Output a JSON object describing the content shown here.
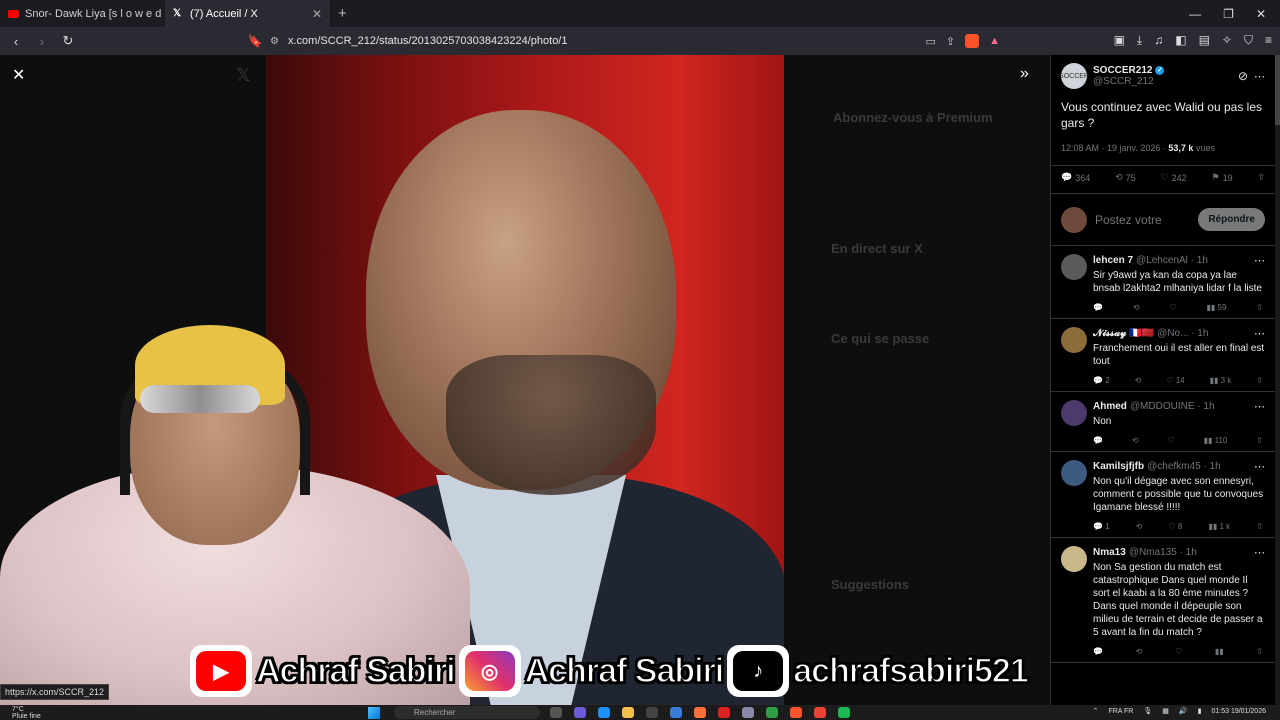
{
  "browser": {
    "tabs": [
      {
        "title": "Snor- Dawk Liya [s l o w e d + reve",
        "icon": "youtube-icon",
        "active": false
      },
      {
        "title": "(7) Accueil / X",
        "icon": "x-icon",
        "active": true
      }
    ],
    "new_tab": "+",
    "window_controls": [
      "—",
      "❐",
      "✕"
    ],
    "url": "x.com/SCCR_212/status/2013025703038423224/photo/1",
    "status_url": "https://x.com/SCCR_212"
  },
  "viewer": {
    "close": "✕",
    "expand": "»",
    "ghost_sidebar": {
      "premium_title": "Abonnez-vous à Premium",
      "live_title": "En direct sur X",
      "happening_title": "Ce qui se passe",
      "suggestions_title": "Suggestions"
    }
  },
  "overlay_banner": {
    "youtube_name": "Achraf Sabiri",
    "instagram_name": "Achraf Sabiri",
    "tiktok_name": "achrafsabiri521"
  },
  "post": {
    "author_name": "SOCCER212",
    "author_handle": "@SCCR_212",
    "avatar_text": "SOCCER",
    "text": "Vous continuez avec Walid ou pas les gars ?",
    "timestamp": "12:08 AM · 19 janv. 2026 · ",
    "views_count": "53,7 k",
    "views_label": " vues",
    "stats": {
      "replies": "364",
      "reposts": "75",
      "likes": "242",
      "bookmarks": "19"
    }
  },
  "reply_box": {
    "placeholder": "Postez votre",
    "button": "Répondre"
  },
  "replies": [
    {
      "name": "lehcen 7",
      "handle": "@LehcenAl · 1h",
      "text": "Sir y9awd ya kan da copa ya lae bnsab l2akhta2 mlhaniya lidar f la liste",
      "replies": "",
      "reposts": "",
      "likes": "",
      "views": "59",
      "avatar_color": "#5a5a5a"
    },
    {
      "name": "𝓝𝓲𝓼𝓼𝓪𝔂 🇫🇷🇲🇦",
      "handle": "@No... · 1h",
      "text": "Franchement oui il est aller en final est tout",
      "replies": "2",
      "reposts": "",
      "likes": "14",
      "views": "3 k",
      "avatar_color": "#8a6d3b"
    },
    {
      "name": "Ahmed",
      "handle": "@MDDOUINE · 1h",
      "text": "Non",
      "replies": "",
      "reposts": "",
      "likes": "",
      "views": "110",
      "avatar_color": "#4b3a6b"
    },
    {
      "name": "Kamilsjfjfb",
      "handle": "@chefkm45 · 1h",
      "text": "Non qu'il dégage avec son ennesyri, comment c possible que tu convoques Igamane blessé !!!!!",
      "replies": "1",
      "reposts": "",
      "likes": "8",
      "views": "1 k",
      "avatar_color": "#3d5a80"
    },
    {
      "name": "Nma13",
      "handle": "@Nma135 · 1h",
      "text": "Non Sa gestion du match est catastrophique Dans quel monde Il sort el kaabi a la 80 ème minutes ? Dans quel monde il dépeuple son milieu de terrain et decide de passer a 5 avant la fin du match ?",
      "replies": "",
      "reposts": "",
      "likes": "",
      "views": "",
      "avatar_color": "#c9b88a"
    }
  ],
  "taskbar": {
    "weather_temp": "7°C",
    "weather_text": "Pluie fine",
    "search_placeholder": "Rechercher",
    "lang": "FRA",
    "lang_sub": "FR",
    "time": "01:53",
    "date": "19/01/2026"
  }
}
